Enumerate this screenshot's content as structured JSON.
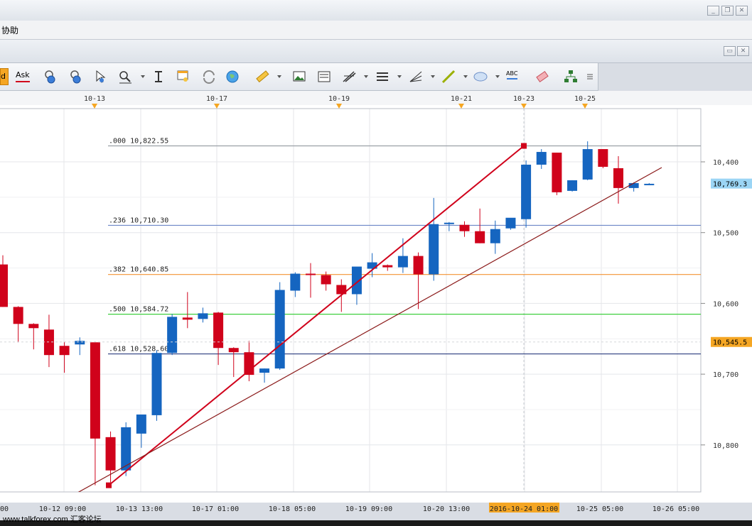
{
  "menu": {
    "help": "协助"
  },
  "toolbar": {
    "partial_label": "d",
    "ask_label": "Ask",
    "text_tool_label": "ABC",
    "items": [
      "bid-button",
      "ask-button",
      "crosshair-icon",
      "zoom-in-icon",
      "pointer-icon",
      "magnifier-icon",
      "vertical-line-icon",
      "chart-properties-icon",
      "refresh-icon",
      "globe-icon",
      "ruler-icon",
      "image-icon",
      "template-icon",
      "trend-lines-icon",
      "horizontal-lines-icon",
      "fan-icon",
      "line-tool-icon",
      "ellipse-icon",
      "text-tool-icon",
      "eraser-icon",
      "hierarchy-icon",
      "menu-overflow-icon"
    ]
  },
  "top_axis": [
    "10-13",
    "10-17",
    "10-19",
    "10-21",
    "10-23",
    "10-25"
  ],
  "bottom_axis": [
    "00",
    "10-12 09:00",
    "10-13 13:00",
    "10-17 01:00",
    "10-18 05:00",
    "10-19 09:00",
    "10-20 13:00",
    "2016-10-24 01:00",
    "10-25 05:00",
    "10-26 05:00"
  ],
  "price_axis": [
    "10,800",
    "10,700",
    "10,600",
    "10,500",
    "10,400"
  ],
  "price_tags": {
    "current": {
      "label": "10,769.3",
      "color": "#9bd5f5"
    },
    "reference": {
      "label": "10,545.5",
      "color": "#f5a623"
    }
  },
  "fib_levels": [
    {
      "ratio": ".000",
      "value": "10,822.55",
      "price": 10822.55,
      "color": "#9aa0a6"
    },
    {
      "ratio": ".236",
      "value": "10,710.30",
      "price": 10710.3,
      "color": "#6d87c7"
    },
    {
      "ratio": ".382",
      "value": "10,640.85",
      "price": 10640.85,
      "color": "#f29233"
    },
    {
      "ratio": ".500",
      "value": "10,584.72",
      "price": 10584.72,
      "color": "#3fcf3f"
    },
    {
      "ratio": ".618",
      "value": "10,528.60",
      "price": 10528.6,
      "color": "#2c3e80"
    }
  ],
  "watermark": "www.talkforex.com 汇客论坛",
  "chart_data": {
    "type": "candlestick",
    "up_color": "#1565c0",
    "down_color": "#d0021b",
    "y_axis": {
      "ticks": [
        10400,
        10500,
        10600,
        10700,
        10800
      ]
    },
    "candles": [
      {
        "o": 10655,
        "h": 10668,
        "l": 10595,
        "c": 10595
      },
      {
        "o": 10595,
        "h": 10596,
        "l": 10545,
        "c": 10571
      },
      {
        "o": 10571,
        "h": 10572,
        "l": 10535,
        "c": 10565
      },
      {
        "o": 10563,
        "h": 10584,
        "l": 10510,
        "c": 10527
      },
      {
        "o": 10540,
        "h": 10546,
        "l": 10502,
        "c": 10527
      },
      {
        "o": 10542,
        "h": 10552,
        "l": 10527,
        "c": 10547
      },
      {
        "o": 10545,
        "h": 10546,
        "l": 10343,
        "c": 10409
      },
      {
        "o": 10411,
        "h": 10419,
        "l": 10347,
        "c": 10364
      },
      {
        "o": 10364,
        "h": 10432,
        "l": 10356,
        "c": 10425
      },
      {
        "o": 10416,
        "h": 10442,
        "l": 10396,
        "c": 10443
      },
      {
        "o": 10442,
        "h": 10534,
        "l": 10434,
        "c": 10530
      },
      {
        "o": 10530,
        "h": 10585,
        "l": 10527,
        "c": 10581
      },
      {
        "o": 10580,
        "h": 10616,
        "l": 10565,
        "c": 10577
      },
      {
        "o": 10578,
        "h": 10594,
        "l": 10573,
        "c": 10586
      },
      {
        "o": 10587,
        "h": 10588,
        "l": 10513,
        "c": 10537
      },
      {
        "o": 10537,
        "h": 10538,
        "l": 10496,
        "c": 10531
      },
      {
        "o": 10531,
        "h": 10547,
        "l": 10490,
        "c": 10499
      },
      {
        "o": 10502,
        "h": 10508,
        "l": 10488,
        "c": 10508
      },
      {
        "o": 10508,
        "h": 10630,
        "l": 10506,
        "c": 10619
      },
      {
        "o": 10618,
        "h": 10644,
        "l": 10609,
        "c": 10642
      },
      {
        "o": 10642,
        "h": 10657,
        "l": 10608,
        "c": 10640
      },
      {
        "o": 10640,
        "h": 10645,
        "l": 10618,
        "c": 10627
      },
      {
        "o": 10626,
        "h": 10634,
        "l": 10588,
        "c": 10613
      },
      {
        "o": 10613,
        "h": 10648,
        "l": 10598,
        "c": 10652
      },
      {
        "o": 10649,
        "h": 10671,
        "l": 10637,
        "c": 10658
      },
      {
        "o": 10654,
        "h": 10655,
        "l": 10646,
        "c": 10651
      },
      {
        "o": 10651,
        "h": 10692,
        "l": 10643,
        "c": 10667
      },
      {
        "o": 10667,
        "h": 10672,
        "l": 10592,
        "c": 10641
      },
      {
        "o": 10641,
        "h": 10749,
        "l": 10632,
        "c": 10712
      },
      {
        "o": 10713,
        "h": 10715,
        "l": 10702,
        "c": 10714
      },
      {
        "o": 10711,
        "h": 10716,
        "l": 10694,
        "c": 10702
      },
      {
        "o": 10702,
        "h": 10734,
        "l": 10685,
        "c": 10685
      },
      {
        "o": 10685,
        "h": 10717,
        "l": 10670,
        "c": 10705
      },
      {
        "o": 10706,
        "h": 10719,
        "l": 10704,
        "c": 10721
      },
      {
        "o": 10719,
        "h": 10802,
        "l": 10707,
        "c": 10796
      },
      {
        "o": 10796,
        "h": 10818,
        "l": 10790,
        "c": 10814
      },
      {
        "o": 10813,
        "h": 10813,
        "l": 10753,
        "c": 10757
      },
      {
        "o": 10759,
        "h": 10774,
        "l": 10758,
        "c": 10774
      },
      {
        "o": 10775,
        "h": 10829,
        "l": 10774,
        "c": 10818
      },
      {
        "o": 10818,
        "h": 10818,
        "l": 10791,
        "c": 10793
      },
      {
        "o": 10791,
        "h": 10808,
        "l": 10741,
        "c": 10763
      },
      {
        "o": 10763,
        "h": 10771,
        "l": 10758,
        "c": 10770
      },
      {
        "o": 10769,
        "h": 10770,
        "l": 10768,
        "c": 10769
      }
    ]
  }
}
